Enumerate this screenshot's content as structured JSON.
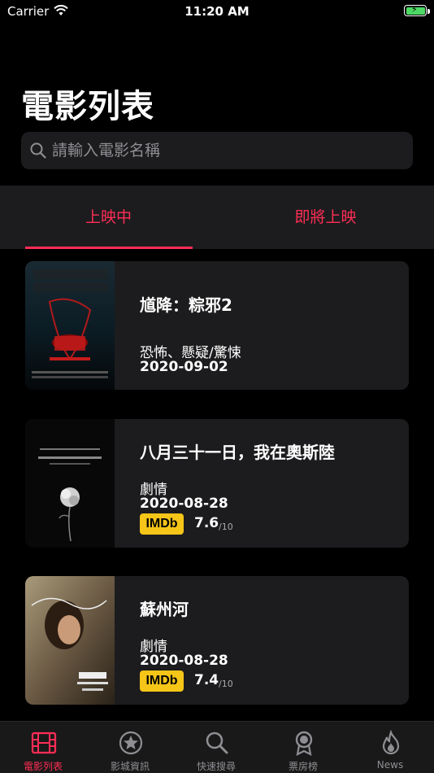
{
  "status_bar": {
    "carrier": "Carrier",
    "time": "11:20 AM"
  },
  "page_title": "電影列表",
  "search": {
    "placeholder": "請輸入電影名稱"
  },
  "tabs": [
    {
      "label": "上映中",
      "selected": true
    },
    {
      "label": "即將上映",
      "selected": false
    }
  ],
  "movies": [
    {
      "title": "馗降：粽邪2",
      "genre": "恐怖、懸疑/驚悚",
      "date": "2020-09-02"
    },
    {
      "title": "八月三十一日，我在奧斯陸",
      "genre": "劇情",
      "date": "2020-08-28",
      "imdb_label": "IMDb",
      "rating": "7.6",
      "rating_max": "/10"
    },
    {
      "title": "蘇州河",
      "genre": "劇情",
      "date": "2020-08-28",
      "imdb_label": "IMDb",
      "rating": "7.4",
      "rating_max": "/10"
    }
  ],
  "tab_bar": [
    {
      "label": "電影列表",
      "icon": "film-icon",
      "active": true
    },
    {
      "label": "影城資訊",
      "icon": "star-circle-icon",
      "active": false
    },
    {
      "label": "快速搜尋",
      "icon": "search-icon",
      "active": false
    },
    {
      "label": "票房榜",
      "icon": "award-icon",
      "active": false
    },
    {
      "label": "News",
      "icon": "flame-icon",
      "active": false
    }
  ],
  "colors": {
    "accent": "#ff2d55",
    "card_bg": "#1c1c1e",
    "imdb": "#f5c518"
  }
}
